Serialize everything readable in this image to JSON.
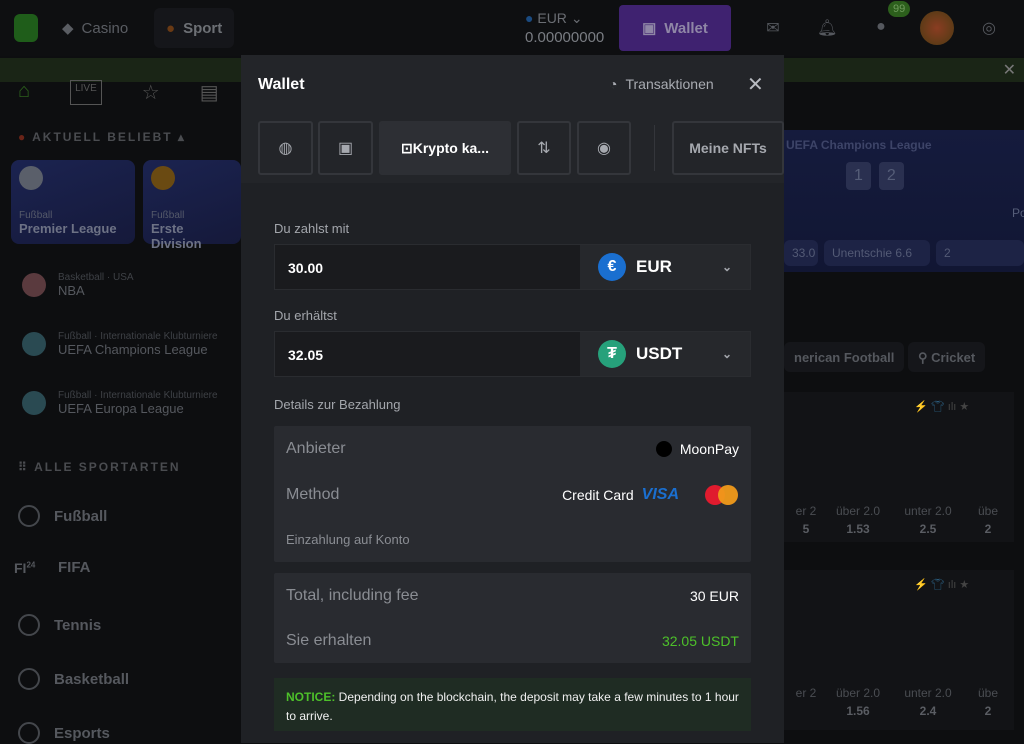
{
  "topbar": {
    "nav": [
      {
        "label": "Casino",
        "icon": "diamond-icon"
      },
      {
        "label": "Sport",
        "icon": "basketball-icon"
      }
    ],
    "currency": "EUR",
    "balance": "0.00000000",
    "wallet_label": "Wallet",
    "chat_badge": "99",
    "icons": [
      "mail-icon",
      "bell-icon",
      "chat-icon",
      "globe-icon"
    ]
  },
  "sidebar": {
    "popular_title": "AKTUELL BELIEBT",
    "cards": [
      {
        "sport": "Fußball",
        "name": "Premier League"
      },
      {
        "sport": "Fußball",
        "name": "Erste Division"
      }
    ],
    "leagues": [
      {
        "sub": "Basketball · USA",
        "name": "NBA"
      },
      {
        "sub": "Fußball · Internationale Klubturniere",
        "name": "UEFA Champions League"
      },
      {
        "sub": "Fußball · Internationale Klubturniere",
        "name": "UEFA Europa League"
      }
    ],
    "all_title": "ALLE SPORTARTEN",
    "sports": [
      "Fußball",
      "FIFA",
      "Tennis",
      "Basketball",
      "Esports"
    ],
    "fifa_badge": "24"
  },
  "background": {
    "banner_title": "UEFA Champions League",
    "banner_scores": [
      "1",
      "2"
    ],
    "banner_team": "Po",
    "odds": [
      "33.0",
      "Unentschie 6.6",
      "2"
    ],
    "chips": [
      "nerican Football",
      "Cricket"
    ],
    "markets": [
      [
        {
          "label": "er 2",
          "value": "5"
        },
        {
          "label": "über 2.0",
          "value": "1.53"
        },
        {
          "label": "unter 2.0",
          "value": "2.5"
        },
        {
          "label": "übe",
          "value": "2"
        }
      ],
      [
        {
          "label": "er 2",
          "value": ""
        },
        {
          "label": "über 2.0",
          "value": "1.56"
        },
        {
          "label": "unter 2.0",
          "value": "2.4"
        },
        {
          "label": "übe",
          "value": "2"
        }
      ]
    ]
  },
  "modal": {
    "title": "Wallet",
    "transactions": "Transaktionen",
    "tabs": [
      {
        "icon": "piggy-bank-icon"
      },
      {
        "icon": "cashier-icon"
      },
      {
        "label": "Krypto ka...",
        "icon": "card-icon",
        "active": true
      },
      {
        "icon": "swap-icon"
      },
      {
        "icon": "coin-icon"
      },
      {
        "label": "Meine NFTs"
      }
    ],
    "pay_label": "Du zahlst mit",
    "pay_value": "30.00",
    "pay_currency": "EUR",
    "receive_label": "Du erhältst",
    "receive_value": "32.05",
    "receive_currency": "USDT",
    "details_label": "Details zur Bezahlung",
    "provider_label": "Anbieter",
    "provider": "MoonPay",
    "method_label": "Method",
    "method": "Credit Card",
    "visa": "VISA",
    "deposit_label": "Einzahlung auf Konto",
    "total_label": "Total, including fee",
    "total": "30 EUR",
    "receive_total_label": "Sie erhalten",
    "receive_total": "32.05 USDT",
    "notice_prefix": "NOTICE:",
    "notice": " Depending on the blockchain, the deposit may take a few minutes to 1 hour to arrive."
  },
  "colors": {
    "accent_purple": "#3f2270",
    "green": "#4dc02a",
    "eur": "#1a6fd0",
    "usdt": "#26a17b"
  }
}
